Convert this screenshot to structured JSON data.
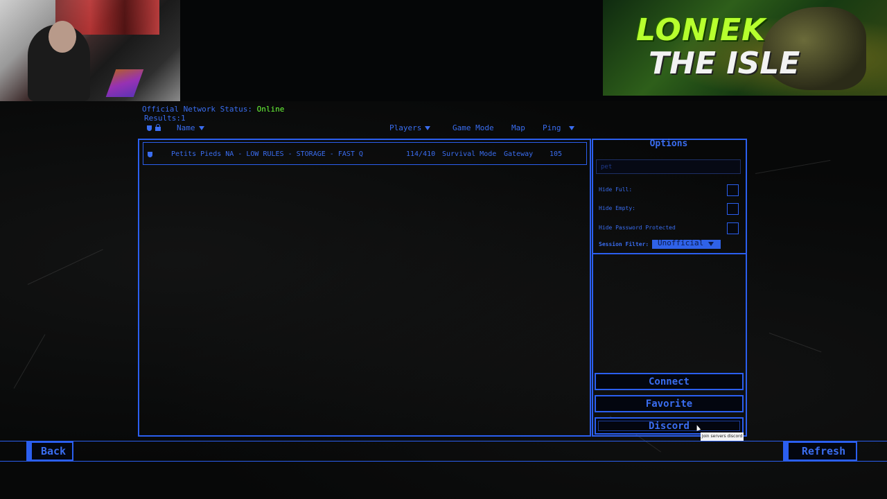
{
  "banner": {
    "line1": "LONIEK",
    "line2": "THE ISLE"
  },
  "header": {
    "status_label": "Official Network Status:",
    "status_value": "Online",
    "results_label": "Results:",
    "results_count": "1"
  },
  "columns": {
    "name": "Name",
    "players": "Players",
    "game_mode": "Game Mode",
    "map": "Map",
    "ping": "Ping"
  },
  "servers": [
    {
      "name": "Petits Pieds NA - LOW RULES - STORAGE - FAST Q",
      "players": "114/410",
      "game_mode": "Survival Mode",
      "map": "Gateway",
      "ping": "105"
    }
  ],
  "options": {
    "title": "Options",
    "search_value": "pet",
    "hide_full": "Hide Full:",
    "hide_empty": "Hide Empty:",
    "hide_password": "Hide Password Protected",
    "session_filter_label": "Session Filter:",
    "session_filter_value": "Unofficial"
  },
  "actions": {
    "connect": "Connect",
    "favorite": "Favorite",
    "discord": "Discord",
    "discord_tooltip": "Join servers discord"
  },
  "footer": {
    "back": "Back",
    "refresh": "Refresh"
  },
  "colors": {
    "accent": "#2b5ff0",
    "online": "#6dff3a",
    "background": "#050607"
  }
}
